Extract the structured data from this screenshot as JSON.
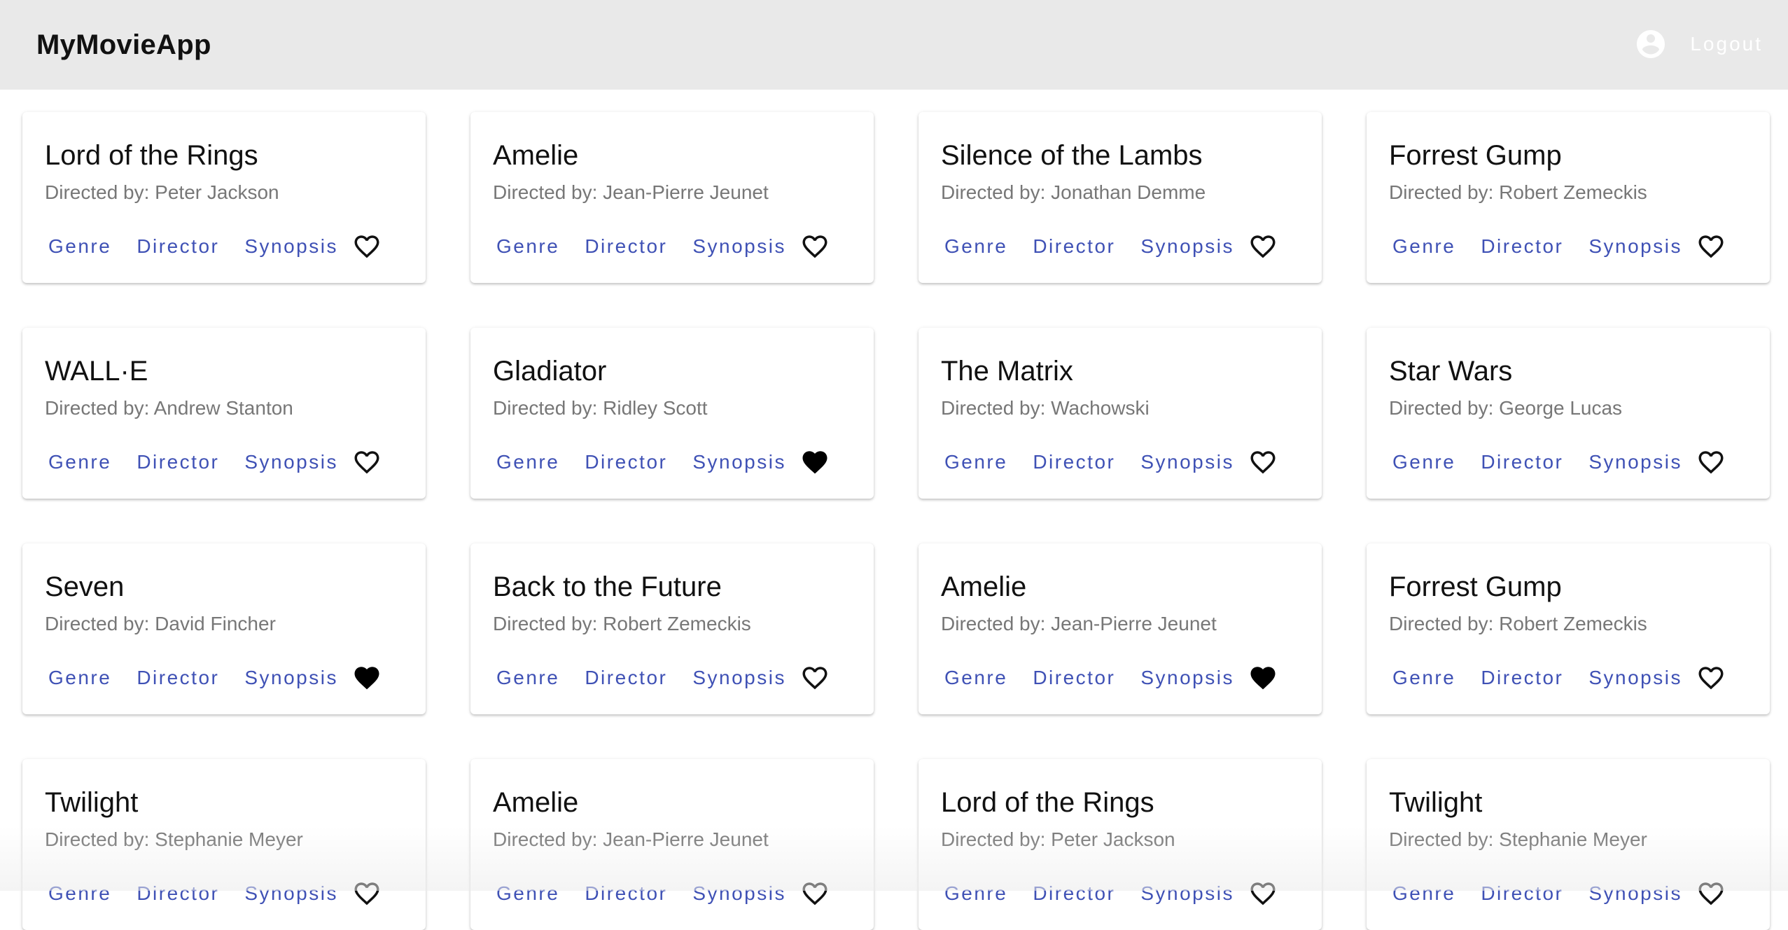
{
  "app": {
    "title": "MyMovieApp",
    "logout_label": "Logout",
    "avatar_icon": "account-circle-icon"
  },
  "colors": {
    "app_bar": "#e9e9e9",
    "action_text": "#3f51b5",
    "subtitle_text": "#777777",
    "logout_text": "#ffffff"
  },
  "movies": [
    {
      "title": "Lord of the Rings",
      "director_line": "Directed by: Peter Jackson",
      "favorite": false
    },
    {
      "title": "Amelie",
      "director_line": "Directed by: Jean-Pierre Jeunet",
      "favorite": false
    },
    {
      "title": "Silence of the Lambs",
      "director_line": "Directed by: Jonathan Demme",
      "favorite": false
    },
    {
      "title": "Forrest Gump",
      "director_line": "Directed by: Robert Zemeckis",
      "favorite": false
    },
    {
      "title": "WALL·E",
      "director_line": "Directed by: Andrew Stanton",
      "favorite": false
    },
    {
      "title": "Gladiator",
      "director_line": "Directed by: Ridley Scott",
      "favorite": true
    },
    {
      "title": "The Matrix",
      "director_line": "Directed by: Wachowski",
      "favorite": false
    },
    {
      "title": "Star Wars",
      "director_line": "Directed by: George Lucas",
      "favorite": false
    },
    {
      "title": "Seven",
      "director_line": "Directed by: David Fincher",
      "favorite": true
    },
    {
      "title": "Back to the Future",
      "director_line": "Directed by: Robert Zemeckis",
      "favorite": false
    },
    {
      "title": "Amelie",
      "director_line": "Directed by: Jean-Pierre Jeunet",
      "favorite": true
    },
    {
      "title": "Forrest Gump",
      "director_line": "Directed by: Robert Zemeckis",
      "favorite": false
    },
    {
      "title": "Twilight",
      "director_line": "Directed by: Stephanie Meyer",
      "favorite": false
    },
    {
      "title": "Amelie",
      "director_line": "Directed by: Jean-Pierre Jeunet",
      "favorite": false
    },
    {
      "title": "Lord of the Rings",
      "director_line": "Directed by: Peter Jackson",
      "favorite": false
    },
    {
      "title": "Twilight",
      "director_line": "Directed by: Stephanie Meyer",
      "favorite": false
    }
  ],
  "card_actions": {
    "genre_label": "Genre",
    "director_label": "Director",
    "synopsis_label": "Synopsis",
    "favorite_icon_filled": "heart-filled-icon",
    "favorite_icon_outline": "heart-outline-icon"
  }
}
